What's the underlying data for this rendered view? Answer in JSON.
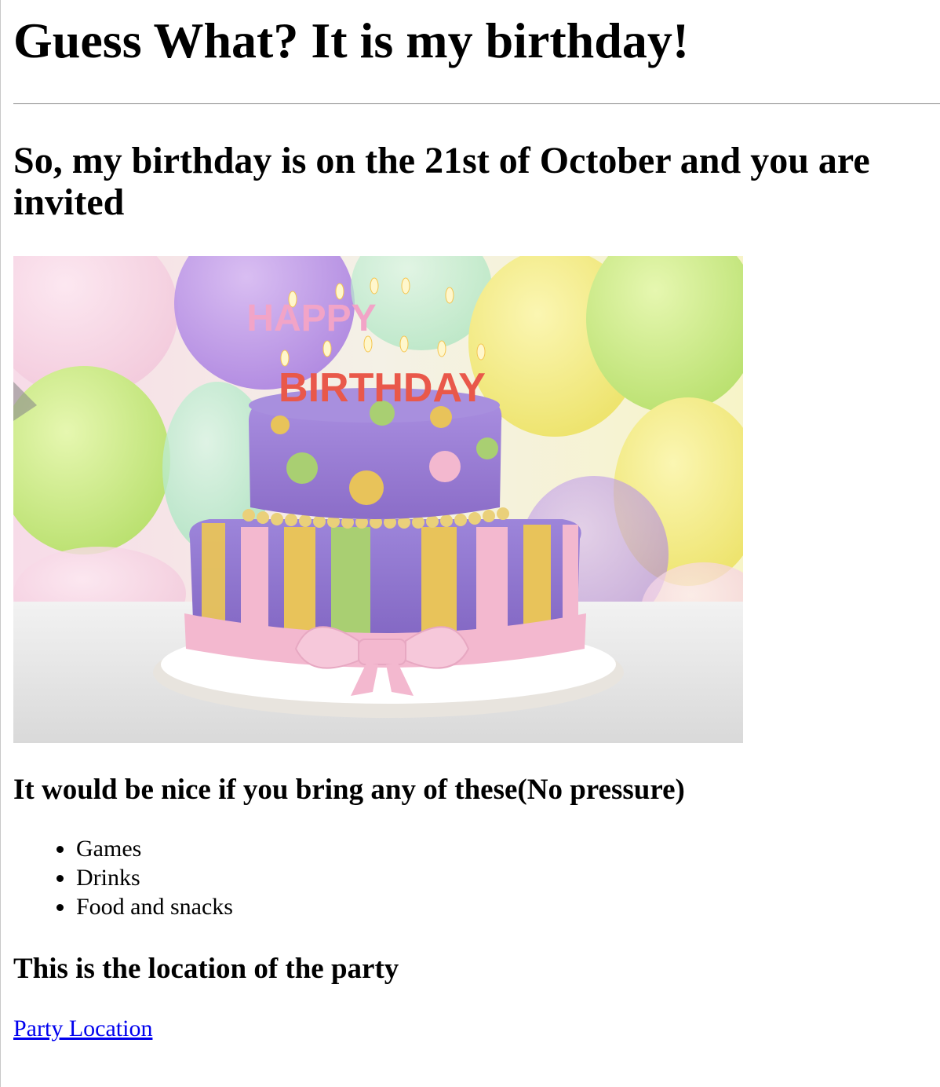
{
  "page": {
    "title": "Guess What? It is my birthday!",
    "subtitle": "So, my birthday is on the 21st of October and you are invited"
  },
  "image": {
    "description_icon": "birthday-cake-image",
    "cake_text_top": "HAPPY",
    "cake_text_bottom": "BIRTHDAY"
  },
  "bring": {
    "heading": "It would be nice if you bring any of these(No pressure)",
    "items": [
      "Games",
      "Drinks",
      "Food and snacks"
    ]
  },
  "location": {
    "heading": "This is the location of the party",
    "link_label": "Party Location"
  },
  "colors": {
    "link": "#0000ee",
    "cake_purple": "#9a7fd1",
    "ribbon_pink": "#f3b8cf",
    "stripe_yellow": "#e8c35a",
    "stripe_green": "#a9cf72"
  }
}
